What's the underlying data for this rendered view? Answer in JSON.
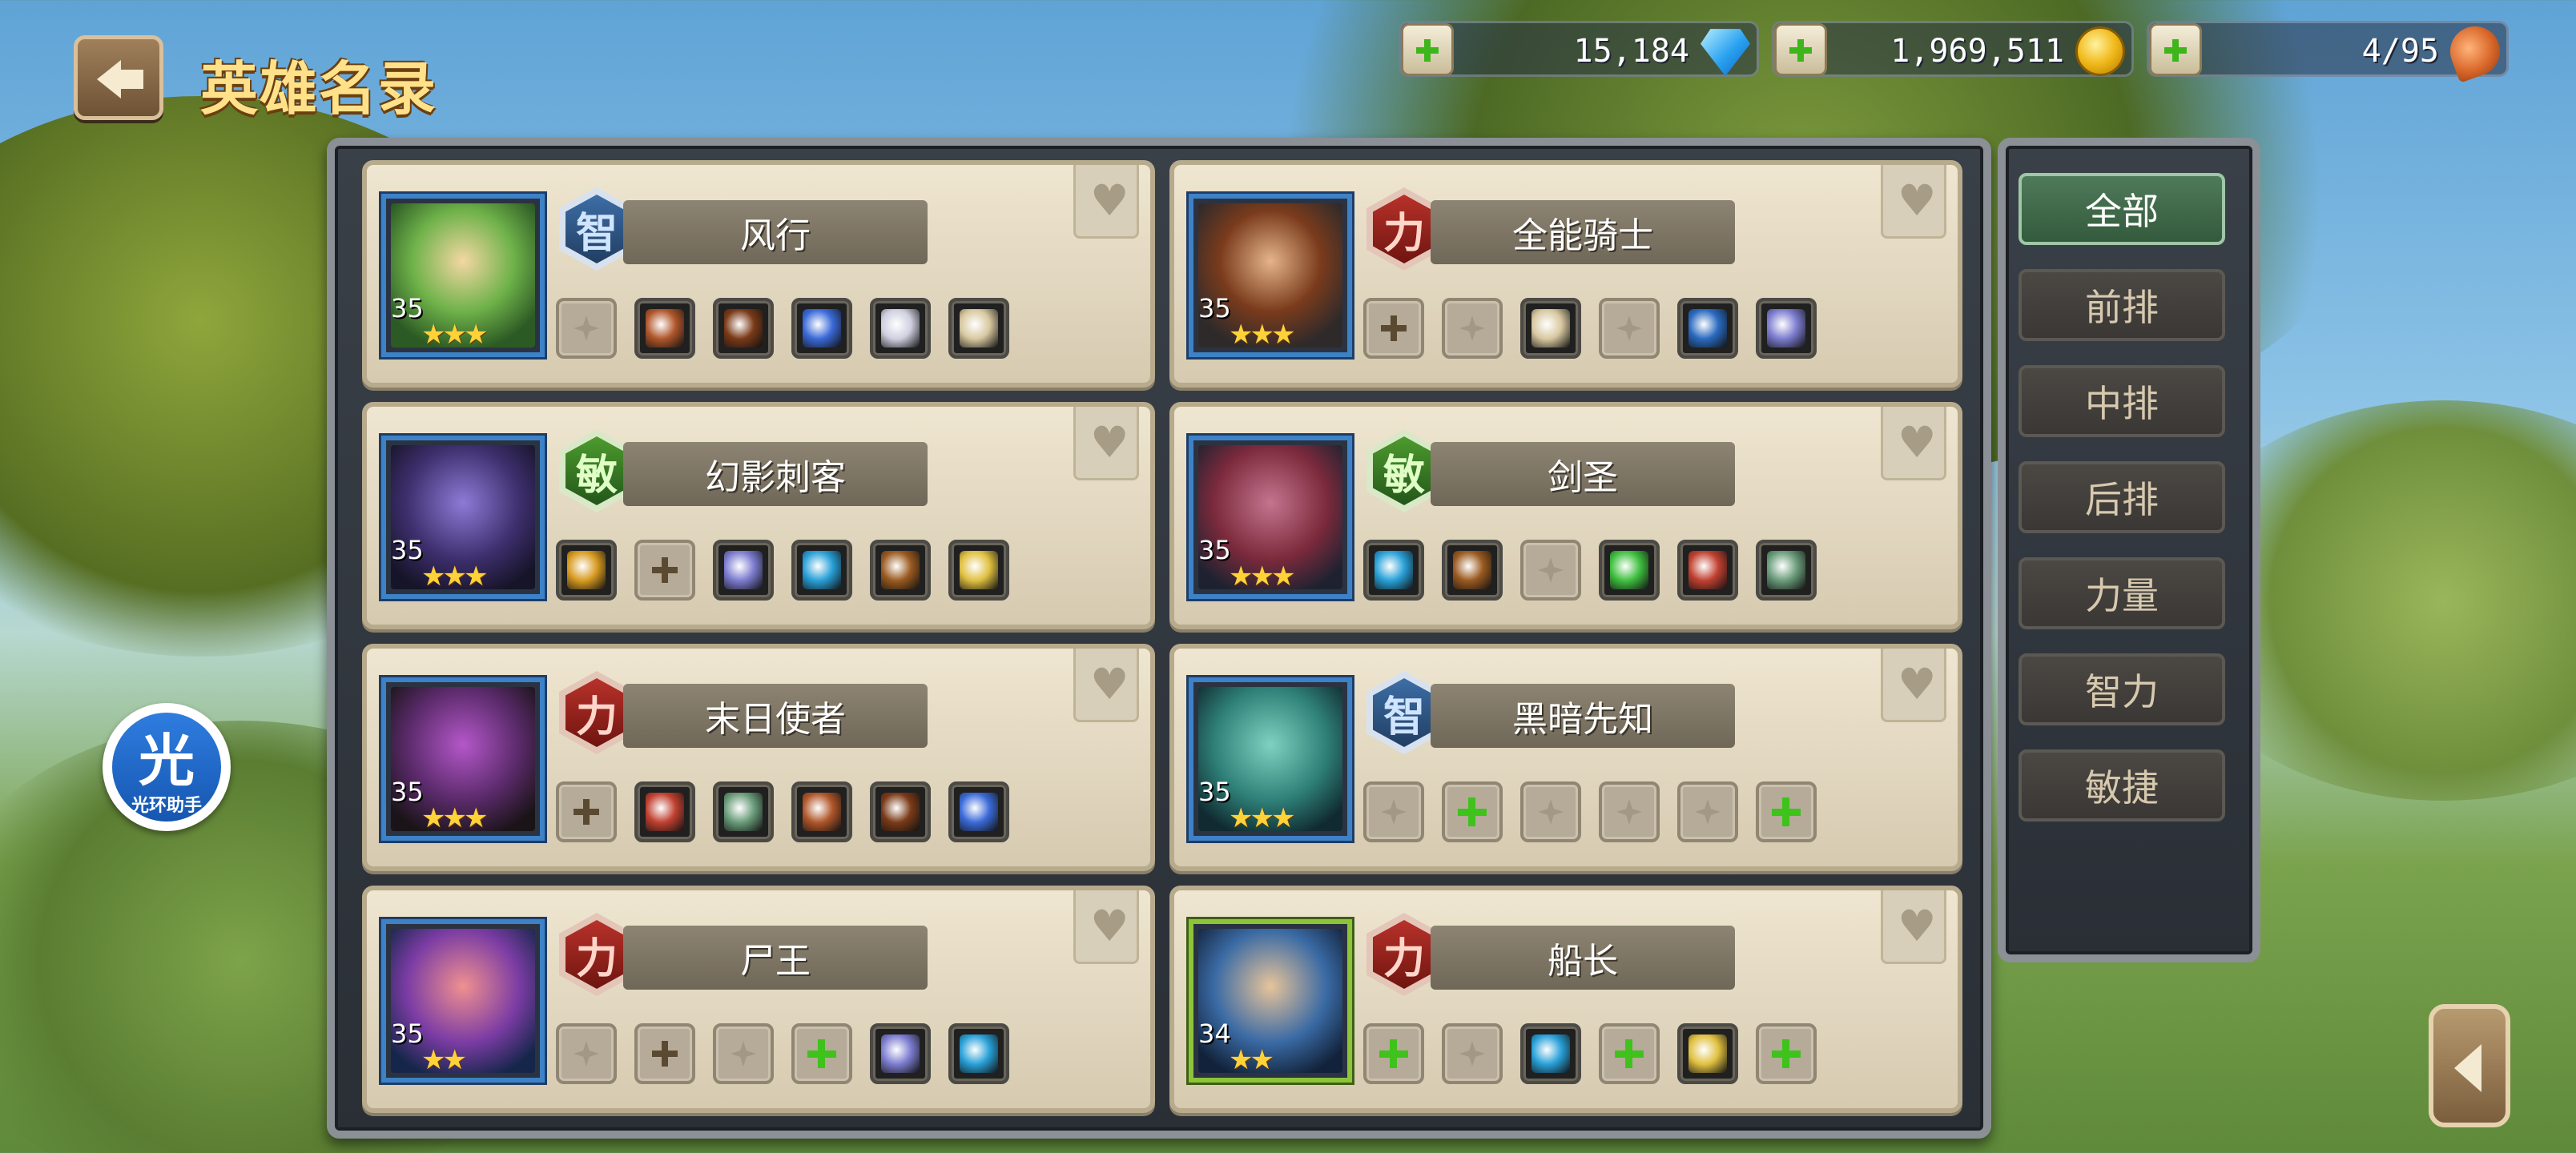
{
  "header": {
    "title": "英雄名录"
  },
  "currencies": [
    {
      "value": "15,184",
      "icon": "diamond-icon"
    },
    {
      "value": "1,969,511",
      "icon": "gold-coins-icon"
    },
    {
      "value": "4/95",
      "icon": "meat-drumstick-icon"
    }
  ],
  "attr_labels": {
    "int": "智",
    "str": "力",
    "agi": "敏"
  },
  "heroes": [
    {
      "name": "风行",
      "level": "35",
      "stars": "★★★",
      "attr": "智",
      "equip": [
        "empty",
        "item",
        "item",
        "item",
        "item",
        "item"
      ]
    },
    {
      "name": "全能骑士",
      "level": "35",
      "stars": "★★★",
      "attr": "力",
      "equip": [
        "add",
        "empty",
        "item",
        "empty",
        "item",
        "item"
      ]
    },
    {
      "name": "幻影刺客",
      "level": "35",
      "stars": "★★★",
      "attr": "敏",
      "equip": [
        "item",
        "add",
        "item",
        "item",
        "item",
        "item"
      ]
    },
    {
      "name": "剑圣",
      "level": "35",
      "stars": "★★★",
      "attr": "敏",
      "equip": [
        "item",
        "item",
        "empty",
        "item",
        "item",
        "item"
      ]
    },
    {
      "name": "末日使者",
      "level": "35",
      "stars": "★★★",
      "attr": "力",
      "equip": [
        "add",
        "item",
        "item",
        "item",
        "item",
        "item"
      ]
    },
    {
      "name": "黑暗先知",
      "level": "35",
      "stars": "★★★",
      "attr": "智",
      "equip": [
        "empty",
        "add-green",
        "empty",
        "empty",
        "empty",
        "add-green"
      ]
    },
    {
      "name": "尸王",
      "level": "35",
      "stars": "★★",
      "attr": "力",
      "equip": [
        "empty",
        "add",
        "empty",
        "add-green",
        "item",
        "item"
      ]
    },
    {
      "name": "船长",
      "level": "34",
      "stars": "★★",
      "attr": "力",
      "equip": [
        "add-green",
        "empty",
        "item",
        "add-green",
        "item",
        "add-green"
      ]
    }
  ],
  "filters": [
    {
      "label": "全部",
      "active": true
    },
    {
      "label": "前排",
      "active": false
    },
    {
      "label": "中排",
      "active": false
    },
    {
      "label": "后排",
      "active": false
    },
    {
      "label": "力量",
      "active": false
    },
    {
      "label": "智力",
      "active": false
    },
    {
      "label": "敏捷",
      "active": false
    }
  ],
  "helper": {
    "char": "光",
    "label": "光环助手"
  }
}
